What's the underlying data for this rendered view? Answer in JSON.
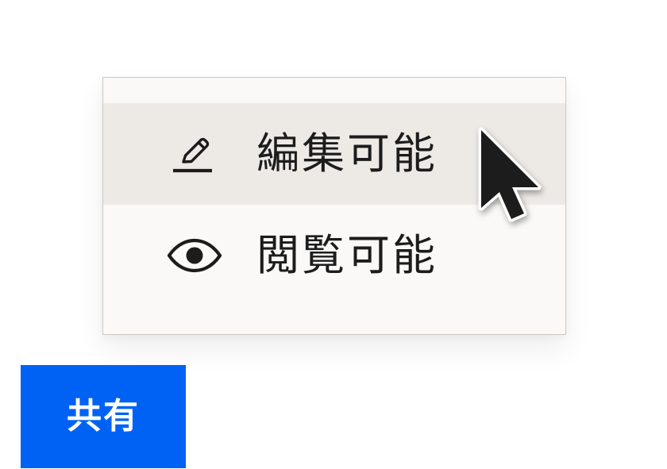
{
  "menu": {
    "items": [
      {
        "label": "編集可能",
        "icon": "pencil-icon",
        "highlighted": true
      },
      {
        "label": "閲覧可能",
        "icon": "eye-icon",
        "highlighted": false
      }
    ]
  },
  "share_button": {
    "label": "共有",
    "color": "#0062f5"
  },
  "colors": {
    "menu_background": "#faf9f7",
    "highlight_background": "#edeae6",
    "menu_border": "#cdc8c1",
    "text": "#1c1c1c"
  }
}
